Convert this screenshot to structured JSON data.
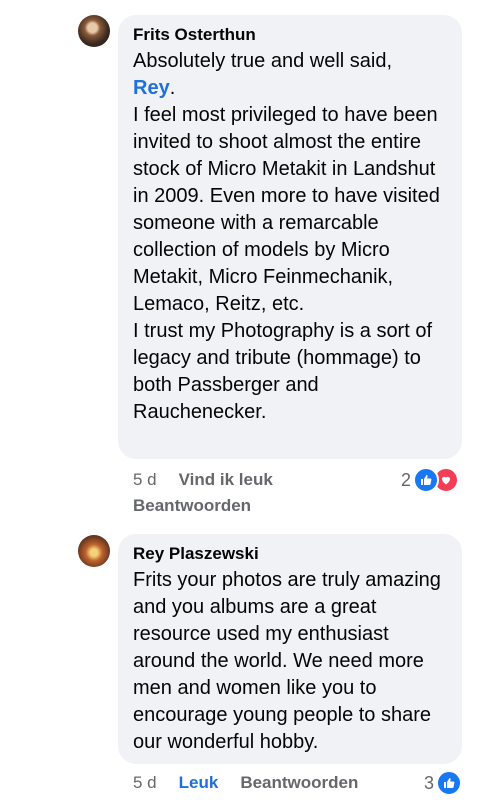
{
  "comments": [
    {
      "author": "Frits Osterthun",
      "lines": [
        "Absolutely true and well said,",
        "Rey",
        "I feel most privileged to have been invited to shoot almost the entire stock of Micro Metakit in Landshut in 2009. Even more to have visited someone with a remarcable collection of models by Micro Metakit, Micro Feinmechanik, Lemaco, Reitz, etc.",
        "I trust my Photography is a sort of legacy and tribute (hommage) to both Passberger and Rauchenecker."
      ],
      "time": "5 d",
      "like_label": "Vind ik leuk",
      "reply_label": "Beantwoorden",
      "reaction_count": "2",
      "reactions": [
        "like-icon",
        "love-icon"
      ]
    },
    {
      "author": "Rey Plaszewski",
      "text": "Frits your photos are truly amazing and you albums are a great resource used my enthusiast around the world.  We need more men and women like you to encourage young people to share our wonderful hobby.",
      "time": "5 d",
      "like_label": "Leuk",
      "reply_label": "Beantwoorden",
      "reaction_count": "3",
      "reactions": [
        "like-icon"
      ]
    }
  ],
  "colors": {
    "bubble": "#f0f2f5",
    "link": "#216fdb",
    "meta": "#65676b"
  }
}
